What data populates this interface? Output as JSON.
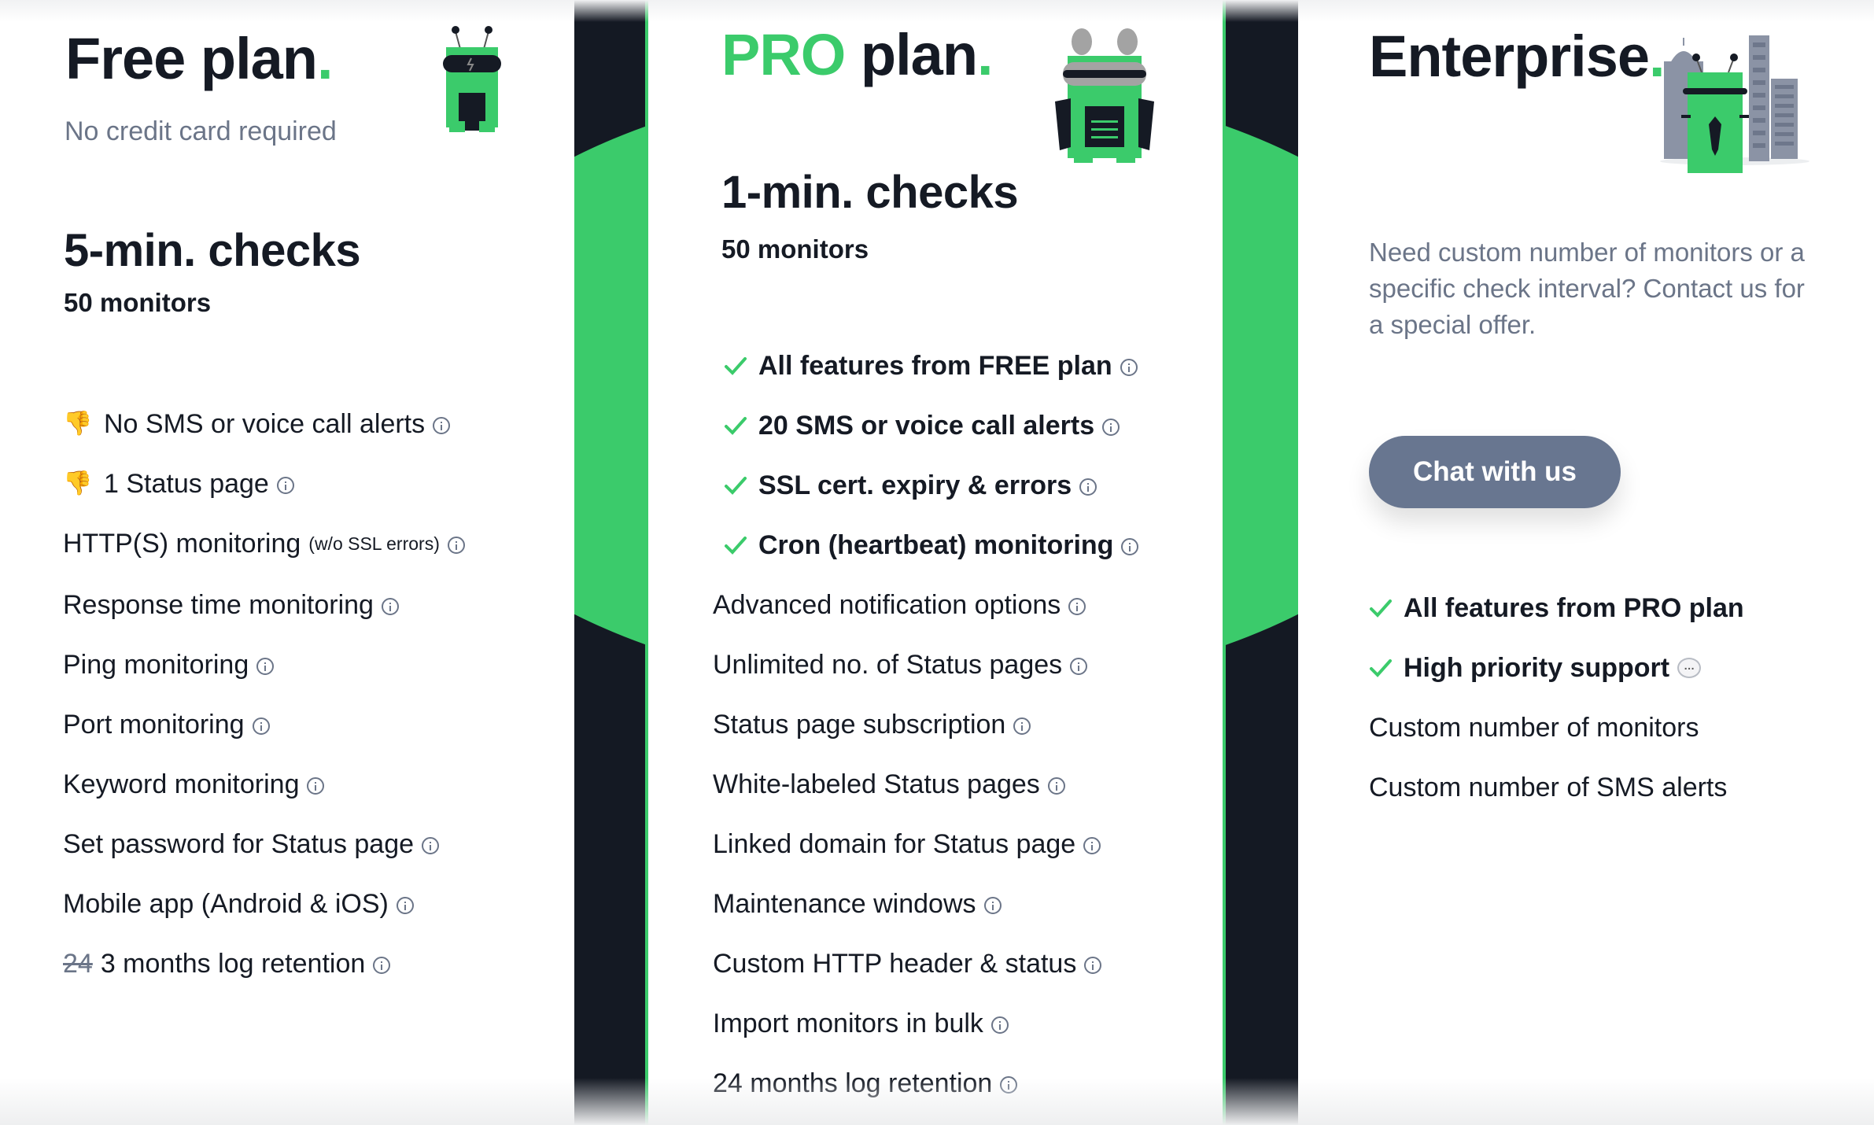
{
  "colors": {
    "brand_green": "#3bcb6b",
    "dark": "#141923",
    "text": "#151a24",
    "muted": "#6b7588",
    "button": "#687690"
  },
  "free": {
    "title": "Free plan",
    "dot": ".",
    "subtitle": "No credit card required",
    "checks": "5-min. checks",
    "monitors": "50 monitors",
    "features": [
      {
        "icon": "thumbs-down",
        "text": "No SMS or voice call alerts",
        "info": true
      },
      {
        "icon": "thumbs-down",
        "text": "1 Status page",
        "info": true
      },
      {
        "text": "HTTP(S) monitoring",
        "note": "(w/o SSL errors)",
        "info": true
      },
      {
        "text": "Response time monitoring",
        "info": true
      },
      {
        "text": "Ping monitoring",
        "info": true
      },
      {
        "text": "Port monitoring",
        "info": true
      },
      {
        "text": "Keyword monitoring",
        "info": true
      },
      {
        "text": "Set password for Status page",
        "info": true
      },
      {
        "text": "Mobile app (Android & iOS)",
        "info": true
      },
      {
        "struck": "24",
        "text": "3 months log retention",
        "info": true
      }
    ]
  },
  "pro": {
    "title_accent": "PRO",
    "title": "plan",
    "dot": ".",
    "checks": "1-min. checks",
    "monitors": "50 monitors",
    "features": [
      {
        "icon": "check",
        "bold": true,
        "text": "All features from FREE plan",
        "info": true
      },
      {
        "icon": "check",
        "bold": true,
        "text": "20 SMS or voice call alerts",
        "info": true
      },
      {
        "icon": "check",
        "bold": true,
        "text": "SSL cert. expiry & errors",
        "info": true
      },
      {
        "icon": "check",
        "bold": true,
        "text": "Cron (heartbeat) monitoring",
        "info": true
      },
      {
        "text": "Advanced notification options",
        "info": true
      },
      {
        "text": "Unlimited no. of Status pages",
        "info": true
      },
      {
        "text": "Status page subscription",
        "info": true
      },
      {
        "text": "White-labeled Status pages",
        "info": true
      },
      {
        "text": "Linked domain for Status page",
        "info": true
      },
      {
        "text": "Maintenance windows",
        "info": true
      },
      {
        "text": "Custom HTTP header & status",
        "info": true
      },
      {
        "text": "Import monitors in bulk",
        "info": true
      },
      {
        "text": "24 months log retention",
        "info": true
      }
    ]
  },
  "enterprise": {
    "title": "Enterprise",
    "dot": ".",
    "description": "Need custom number of monitors or a specific check interval? Contact us for a special offer.",
    "button_label": "Chat with us",
    "features": [
      {
        "icon": "check",
        "bold": true,
        "text": "All features from PRO plan"
      },
      {
        "icon": "check",
        "bold": true,
        "text": "High priority support",
        "bubble": "…"
      },
      {
        "text": "Custom number of monitors"
      },
      {
        "text": "Custom number of SMS alerts"
      }
    ]
  }
}
